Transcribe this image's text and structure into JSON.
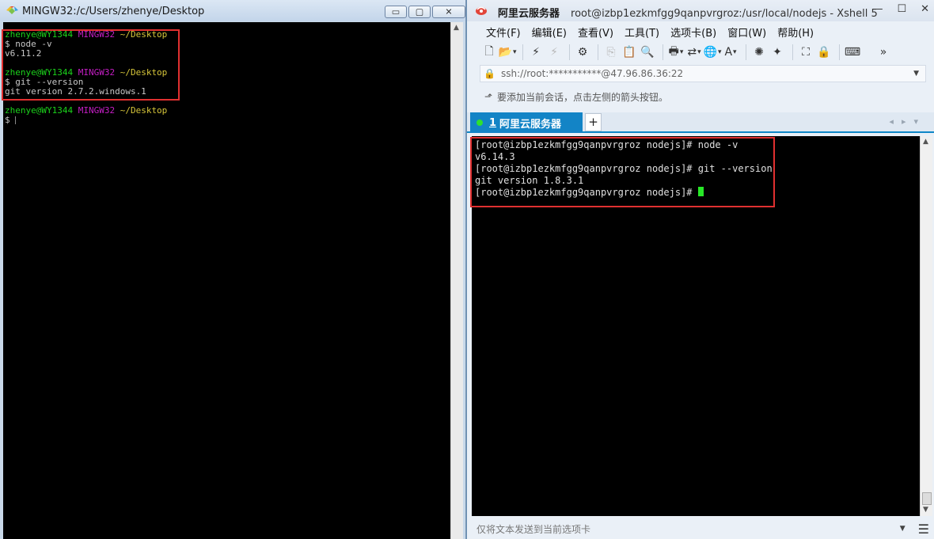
{
  "mingw": {
    "title": "MINGW32:/c/Users/zhenye/Desktop",
    "controls": {
      "minimize": "▭",
      "maximize": "▢",
      "close": "✕"
    },
    "terminal": [
      {
        "user": "zhenye@WY1344",
        "host": "MINGW32",
        "path": "~/Desktop"
      },
      {
        "text": "$ node -v"
      },
      {
        "text": "v6.11.2"
      },
      {
        "user": "zhenye@WY1344",
        "host": "MINGW32",
        "path": "~/Desktop"
      },
      {
        "text": "$ git --version"
      },
      {
        "text": "git version 2.7.2.windows.1"
      },
      {
        "user": "zhenye@WY1344",
        "host": "MINGW32",
        "path": "~/Desktop"
      },
      {
        "text": "$ "
      }
    ]
  },
  "xshell": {
    "title_main": "阿里云服务器",
    "title_sub": "root@izbp1ezkmfgg9qanpvrgroz:/usr/local/nodejs - Xshell 5",
    "controls": {
      "minimize": "—",
      "maximize": "☐",
      "close": "✕"
    },
    "menu": [
      "文件(F)",
      "编辑(E)",
      "查看(V)",
      "工具(T)",
      "选项卡(B)",
      "窗口(W)",
      "帮助(H)"
    ],
    "address": "ssh://root:***********@47.96.86.36:22",
    "hint": "要添加当前会话，点击左侧的箭头按钮。",
    "tab": {
      "number": "1",
      "label": "阿里云服务器"
    },
    "new_tab": "+",
    "terminal": [
      "[root@izbp1ezkmfgg9qanpvrgroz nodejs]# node -v",
      "v6.14.3",
      "[root@izbp1ezkmfgg9qanpvrgroz nodejs]# git --version",
      "git version 1.8.3.1",
      "[root@izbp1ezkmfgg9qanpvrgroz nodejs]# "
    ],
    "send_placeholder": "仅将文本发送到当前选项卡"
  }
}
